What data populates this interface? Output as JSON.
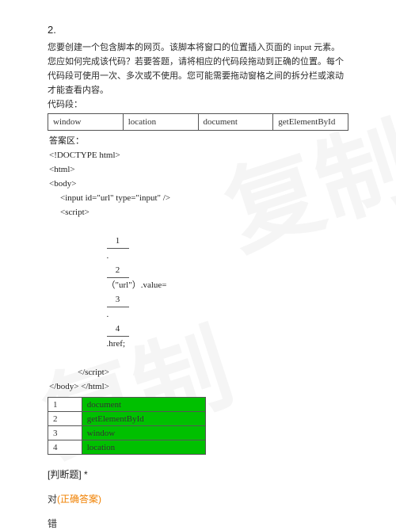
{
  "watermark": "复制",
  "qnum": "2.",
  "desc_lines": [
    "您要创建一个包含脚本的网页。该脚本将窗口的位置插入页面的 input 元素。",
    "您应如何完成该代码？若要答题，请将相应的代码段拖动到正确的位置。每个代码段可使用一次、多次或不使用。您可能需要拖动窗格之间的拆分栏或滚动才能查看内容。",
    "代码段："
  ],
  "opts": {
    "c1": "window",
    "c2": "location",
    "c3": "document",
    "c4": "getElementById"
  },
  "code": {
    "ans_label": "答案区：",
    "l1": "<!DOCTYPE html>",
    "l2": "<html>",
    "l3": "<body>",
    "l4": "<input id=\"url\" type=\"input\" />",
    "l5": "<script>",
    "fill": {
      "b1": "1",
      "dot1": ".",
      "b2": "2",
      "mid": "（\"url\"）.value=",
      "b3": "3",
      "dot2": ".",
      "b4": "4",
      "tail": ".href;"
    },
    "l7": "</script>",
    "l8": "</body>",
    "l9": "</html>"
  },
  "answers": [
    {
      "i": "1",
      "v": "document"
    },
    {
      "i": "2",
      "v": "getElementById"
    },
    {
      "i": "3",
      "v": "window"
    },
    {
      "i": "4",
      "v": "location"
    }
  ],
  "judge_label": "[判断题] *",
  "choice_true": "对",
  "correct_mark": "(正确答案)",
  "choice_false": "错"
}
